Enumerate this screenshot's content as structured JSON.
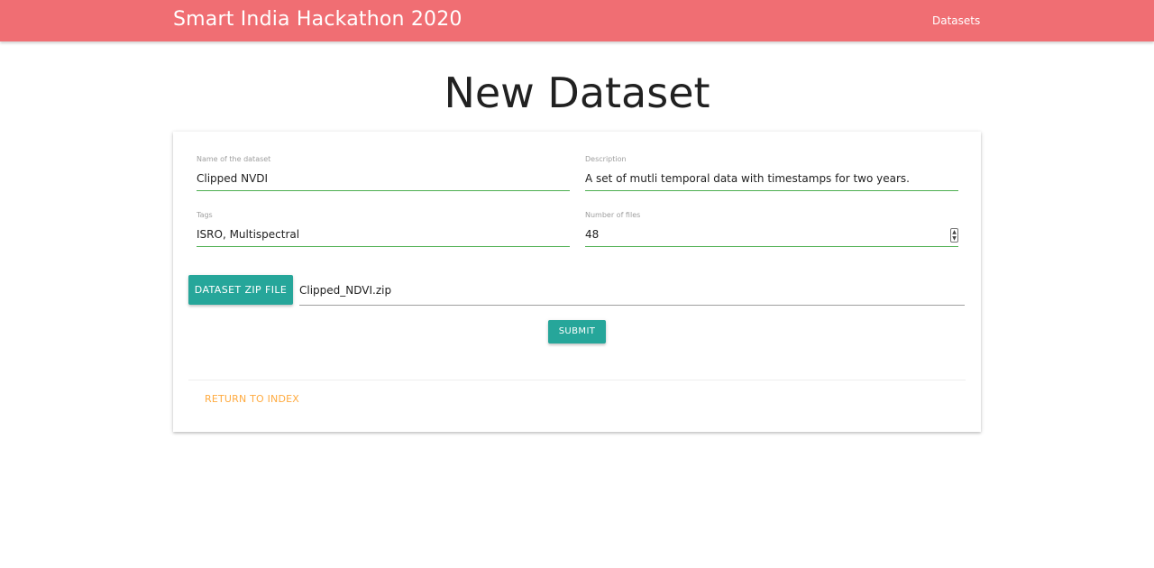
{
  "navbar": {
    "brand": "Smart India Hackathon 2020",
    "links": [
      "Datasets"
    ],
    "color": "#f06e73"
  },
  "page": {
    "title": "New Dataset"
  },
  "form": {
    "name": {
      "label": "Name of the dataset",
      "value": "Clipped NVDI"
    },
    "description": {
      "label": "Description",
      "value": "A set of mutli temporal data with timestamps for two years."
    },
    "tags": {
      "label": "Tags",
      "value": "ISRO, Multispectral"
    },
    "num_files": {
      "label": "Number of files",
      "value": "48"
    },
    "file_button": "DATASET ZIP FILE",
    "file_name": "Clipped_NDVI.zip",
    "submit": "SUBMIT",
    "return_link": "RETURN TO INDEX"
  },
  "colors": {
    "accent": "#26a69a",
    "input_active": "#4caf50",
    "link": "#ffab40"
  }
}
